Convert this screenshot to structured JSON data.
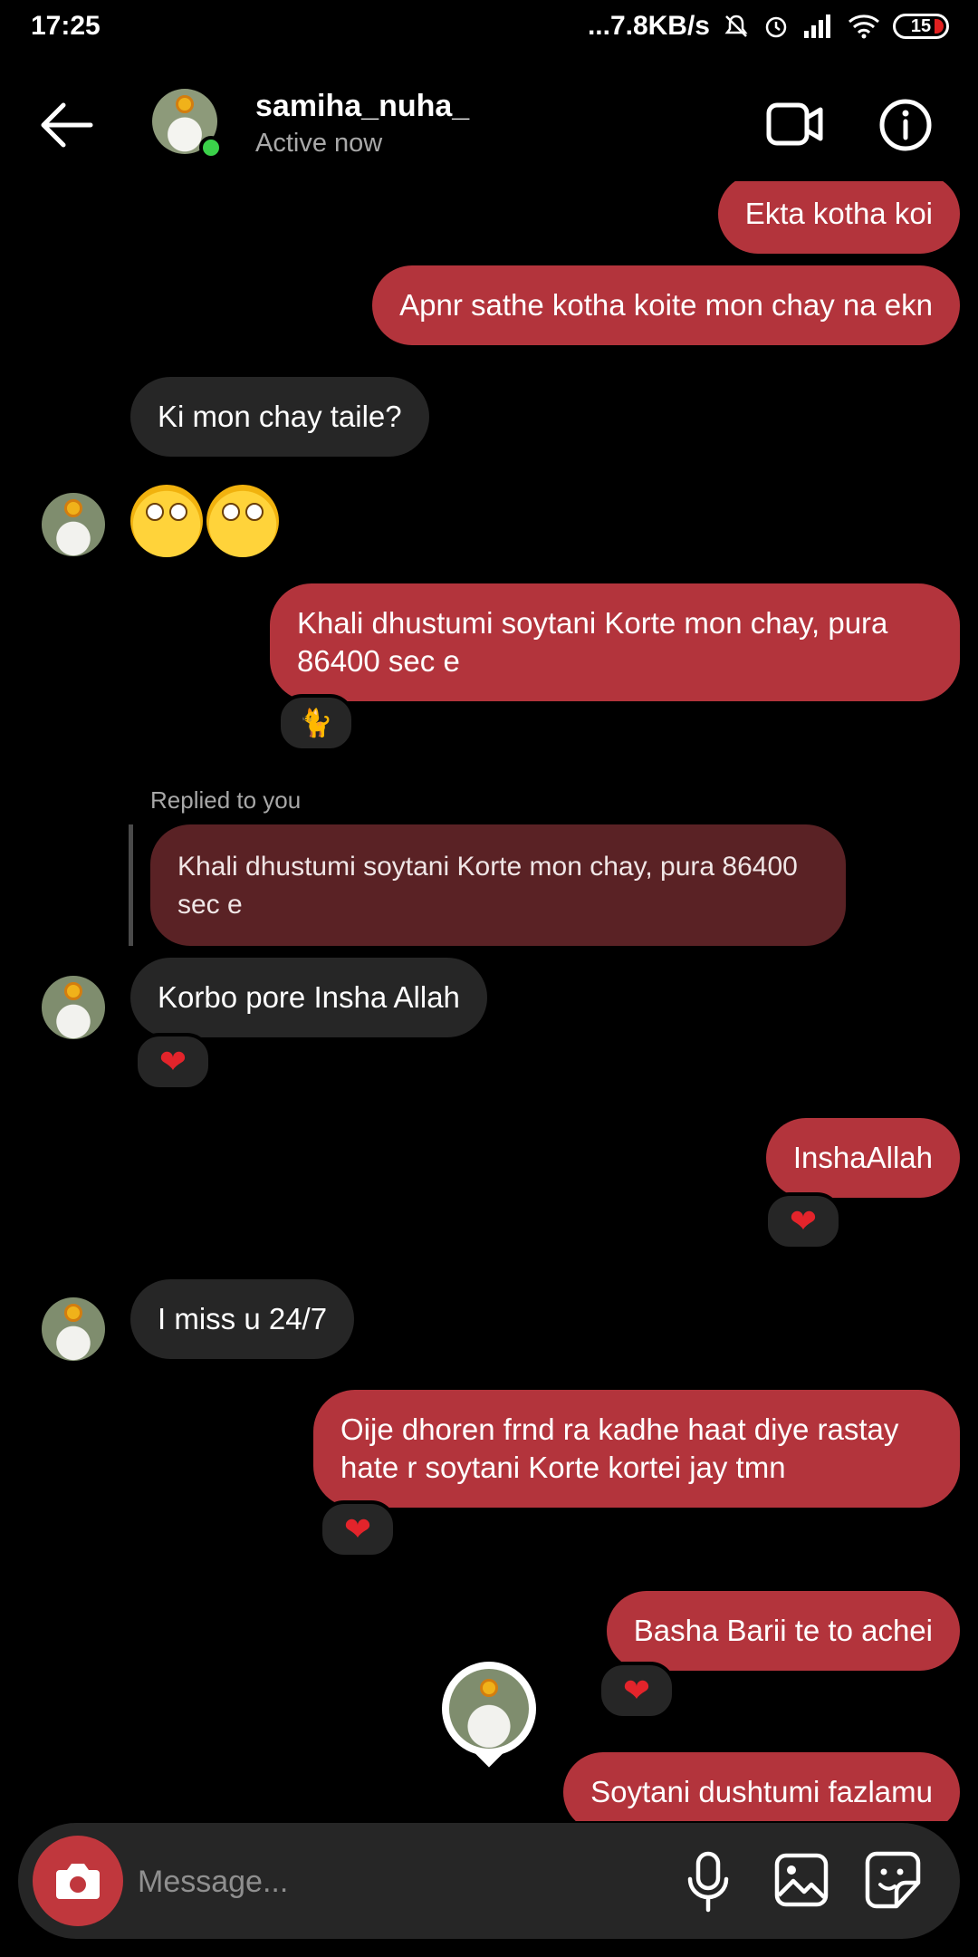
{
  "status_bar": {
    "time": "17:25",
    "network_speed": "...7.8KB/s",
    "battery_level": "15"
  },
  "header": {
    "username": "samiha_nuha_",
    "status": "Active now"
  },
  "messages": [
    {
      "sender": "me",
      "text": "Ekta kotha koi"
    },
    {
      "sender": "me",
      "text": "Apnr sathe kotha koite mon chay na ekn"
    },
    {
      "sender": "them",
      "text": "Ki mon chay taile?"
    },
    {
      "sender": "them",
      "text": "🙄🙄"
    },
    {
      "sender": "me",
      "text": "Khali dhustumi soytani Korte mon chay, pura 86400 sec e",
      "reaction": "🐈"
    },
    {
      "sender": "them",
      "reply_label": "Replied to you",
      "quoted": "Khali dhustumi soytani Korte mon chay, pura 86400 sec e",
      "text": "Korbo pore Insha Allah",
      "reaction": "❤"
    },
    {
      "sender": "me",
      "text": "InshaAllah",
      "reaction": "❤"
    },
    {
      "sender": "them",
      "text": "I miss u 24/7"
    },
    {
      "sender": "me",
      "text": "Oije dhoren frnd ra kadhe haat diye rastay hate r soytani Korte kortei jay tmn",
      "reaction": "❤"
    },
    {
      "sender": "me",
      "text": "Basha Barii te to achei",
      "reaction": "❤"
    },
    {
      "sender": "me",
      "text": "Soytani dushtumi fazlamu"
    }
  ],
  "composer": {
    "placeholder": "Message..."
  },
  "colors": {
    "my_bubble": "#b3343c",
    "their_bubble": "#262626",
    "online": "#3bd14a"
  }
}
